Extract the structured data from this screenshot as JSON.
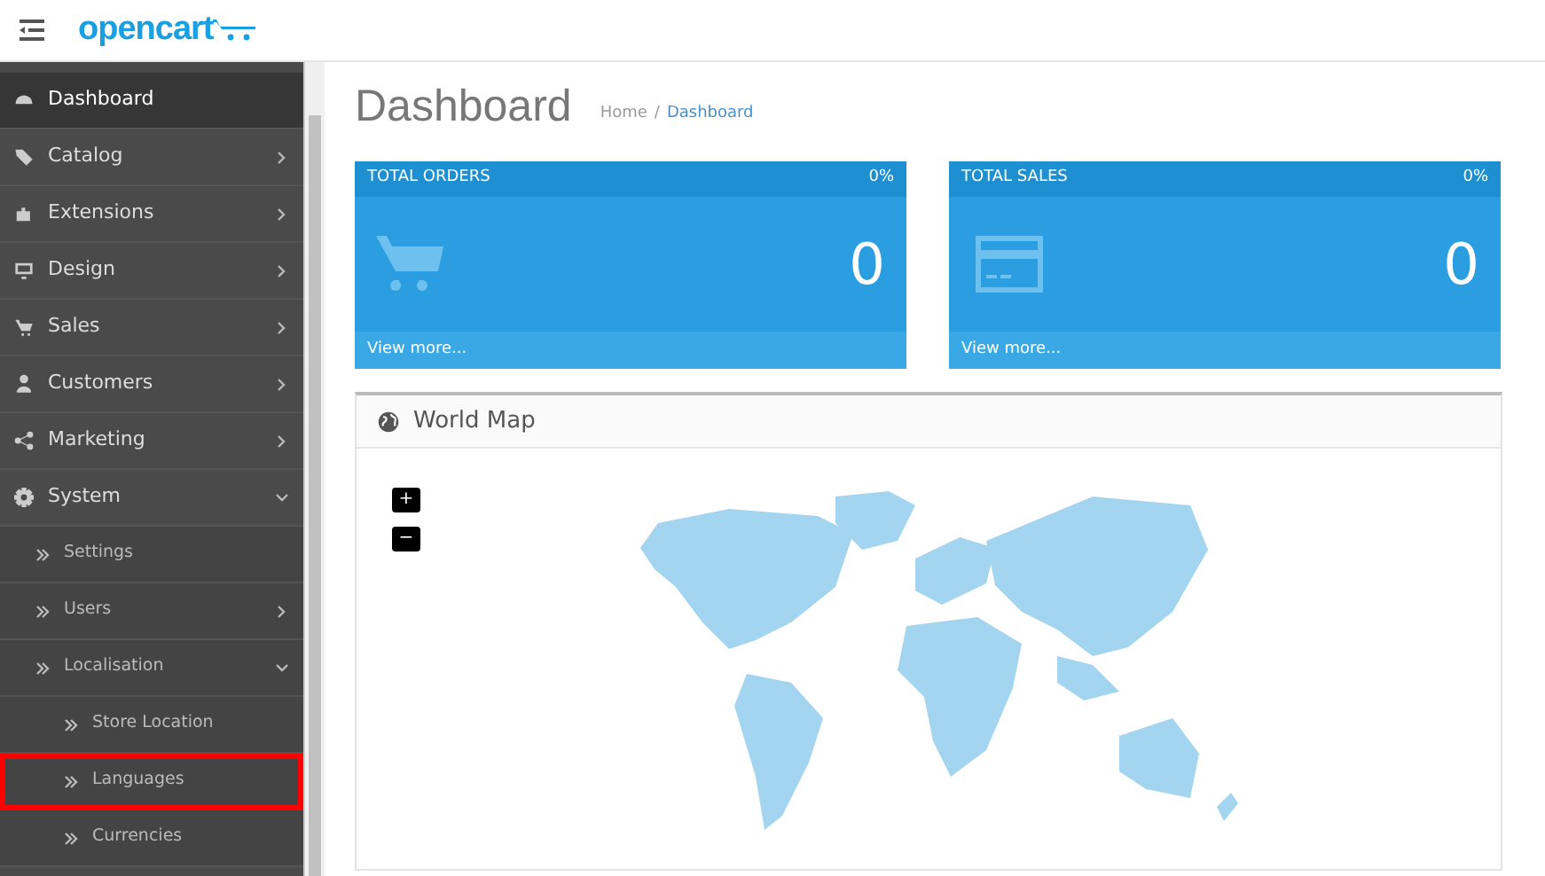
{
  "header": {
    "logo": "opencart"
  },
  "sidebar": {
    "items": [
      {
        "label": "Dashboard",
        "selected": true
      },
      {
        "label": "Catalog",
        "selected": false,
        "expanded": false
      },
      {
        "label": "Extensions",
        "selected": false,
        "expanded": false
      },
      {
        "label": "Design",
        "selected": false,
        "expanded": false
      },
      {
        "label": "Sales",
        "selected": false,
        "expanded": false
      },
      {
        "label": "Customers",
        "selected": false,
        "expanded": false
      },
      {
        "label": "Marketing",
        "selected": false,
        "expanded": false
      },
      {
        "label": "System",
        "selected": false,
        "expanded": true,
        "children": [
          {
            "label": "Settings",
            "selected": false,
            "highlighted": false
          },
          {
            "label": "Users",
            "selected": false,
            "expanded": false,
            "highlighted": false
          },
          {
            "label": "Localisation",
            "selected": false,
            "expanded": true,
            "highlighted": false,
            "children": [
              {
                "label": "Store Location",
                "selected": false,
                "highlighted": false
              },
              {
                "label": "Languages",
                "selected": false,
                "highlighted": true
              },
              {
                "label": "Currencies",
                "selected": false,
                "highlighted": false
              }
            ]
          }
        ]
      }
    ]
  },
  "page": {
    "title": "Dashboard",
    "breadcrumb": [
      {
        "label": "Home",
        "selected": false
      },
      {
        "label": "Dashboard",
        "selected": true
      }
    ],
    "breadcrumb_separator": "/"
  },
  "tiles": [
    {
      "title": "TOTAL ORDERS",
      "percent": "0%",
      "value": "0",
      "link": "View more..."
    },
    {
      "title": "TOTAL SALES",
      "percent": "0%",
      "value": "0",
      "link": "View more..."
    }
  ],
  "world_map": {
    "title": "World Map",
    "zoom_in": "+",
    "zoom_out": "−"
  }
}
